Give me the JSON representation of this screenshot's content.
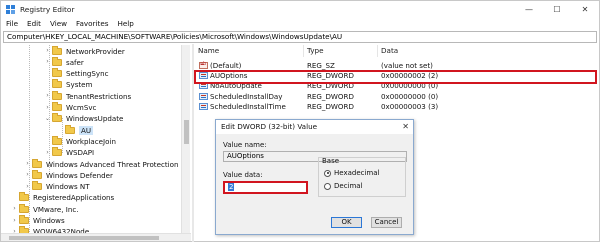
{
  "window": {
    "title": "Registry Editor",
    "controls": {
      "minimize": "—",
      "maximize": "☐",
      "close": "✕"
    }
  },
  "menu": [
    "File",
    "Edit",
    "View",
    "Favorites",
    "Help"
  ],
  "address": "Computer\\HKEY_LOCAL_MACHINE\\SOFTWARE\\Policies\\Microsoft\\Windows\\WindowsUpdate\\AU",
  "tree": [
    {
      "label": "NetworkProvider",
      "chevron": "›",
      "selected": false
    },
    {
      "label": "safer",
      "chevron": "›",
      "selected": false
    },
    {
      "label": "SettingSync",
      "chevron": "",
      "selected": false
    },
    {
      "label": "System",
      "chevron": "",
      "selected": false
    },
    {
      "label": "TenantRestrictions",
      "chevron": "›",
      "selected": false
    },
    {
      "label": "WcmSvc",
      "chevron": "›",
      "selected": false
    },
    {
      "label": "WindowsUpdate",
      "chevron": "⌄",
      "selected": false
    },
    {
      "label": "AU",
      "chevron": "",
      "selected": true
    },
    {
      "label": "WorkplaceJoin",
      "chevron": "",
      "selected": false
    },
    {
      "label": "WSDAPI",
      "chevron": "›",
      "selected": false
    },
    {
      "label": "Windows Advanced Threat Protection",
      "chevron": "›",
      "selected": false
    },
    {
      "label": "Windows Defender",
      "chevron": "›",
      "selected": false
    },
    {
      "label": "Windows NT",
      "chevron": "›",
      "selected": false
    },
    {
      "label": "RegisteredApplications",
      "chevron": "",
      "selected": false
    },
    {
      "label": "VMware, Inc.",
      "chevron": "›",
      "selected": false
    },
    {
      "label": "Windows",
      "chevron": "›",
      "selected": false
    },
    {
      "label": "WOW6432Node",
      "chevron": "›",
      "selected": false
    }
  ],
  "values_table": {
    "headers": {
      "name": "Name",
      "type": "Type",
      "data": "Data"
    },
    "rows": [
      {
        "name": "(Default)",
        "type": "REG_SZ",
        "data": "(value not set)",
        "icon": "string-value-icon"
      },
      {
        "name": "AUOptions",
        "type": "REG_DWORD",
        "data": "0x00000002 (2)",
        "icon": "dword-value-icon"
      },
      {
        "name": "NoAutoUpdate",
        "type": "REG_DWORD",
        "data": "0x00000000 (0)",
        "icon": "dword-value-icon"
      },
      {
        "name": "ScheduledInstallDay",
        "type": "REG_DWORD",
        "data": "0x00000000 (0)",
        "icon": "dword-value-icon"
      },
      {
        "name": "ScheduledInstallTime",
        "type": "REG_DWORD",
        "data": "0x00000003 (3)",
        "icon": "dword-value-icon"
      }
    ]
  },
  "dialog": {
    "title": "Edit DWORD (32-bit) Value",
    "close": "✕",
    "value_name_label": "Value name:",
    "value_name": "AUOptions",
    "value_data_label": "Value data:",
    "value_data": "2",
    "base_label": "Base",
    "base_options": [
      {
        "label": "Hexadecimal",
        "checked": true
      },
      {
        "label": "Decimal",
        "checked": false
      }
    ],
    "ok": "OK",
    "cancel": "Cancel"
  },
  "colors": {
    "highlight": "#d1151f",
    "selection": "#cce3f8",
    "folder": "#f1c84a"
  }
}
